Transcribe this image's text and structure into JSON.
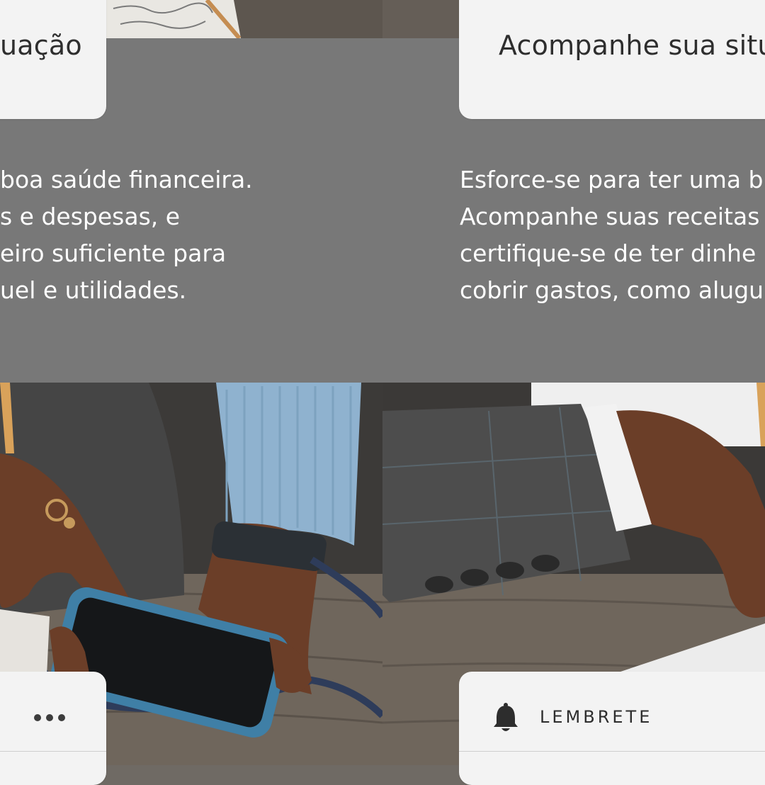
{
  "left_panel": {
    "title": "uação",
    "body_lines": [
      "boa saúde financeira.",
      "s e despesas, e",
      "eiro suficiente para",
      "uel e utilidades."
    ],
    "more_icon": "more-dots-icon"
  },
  "right_panel": {
    "title": "Acompanhe sua situ",
    "body_lines": [
      "Esforce-se para ter uma b",
      "Acompanhe suas receitas",
      "certifique-se de ter dinhe",
      "cobrir gastos, como alugu"
    ],
    "reminder_icon": "bell-icon",
    "reminder_label": "LEMBRETE"
  },
  "colors": {
    "band": "#787878",
    "card": "#f3f3f3",
    "text_on_band": "#ffffff",
    "jacket": "#4b4b4b",
    "sweater": "#8fb2cf",
    "phone_case": "#3f7fa6",
    "wood": "#6f665c"
  }
}
